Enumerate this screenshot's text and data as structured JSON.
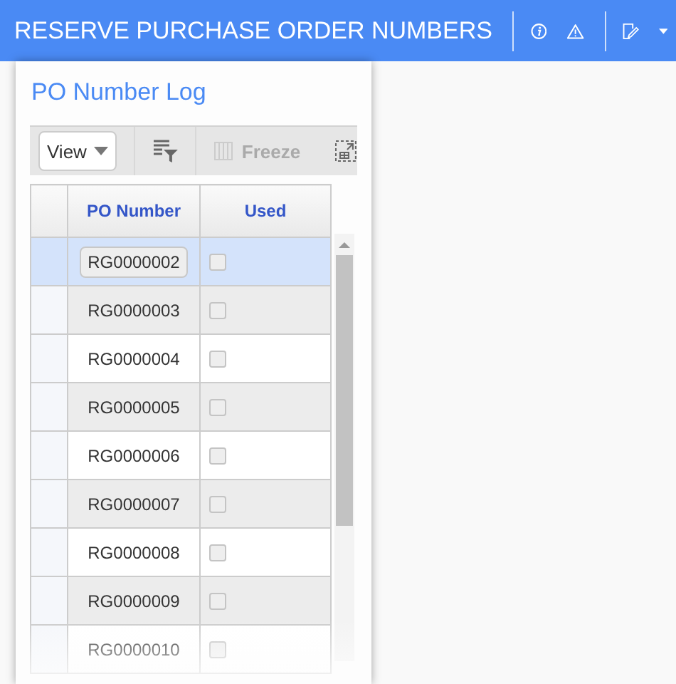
{
  "window": {
    "title": "RESERVE PURCHASE ORDER NUMBERS"
  },
  "panel": {
    "title": "PO Number Log",
    "toolbar": {
      "view": "View",
      "freeze": {
        "label": "Freeze",
        "disabled": true
      }
    },
    "table": {
      "columns": [
        "PO Number",
        "Used"
      ],
      "rows": [
        {
          "po": "RG0000002",
          "used": false,
          "selected": true
        },
        {
          "po": "RG0000003",
          "used": false,
          "selected": false
        },
        {
          "po": "RG0000004",
          "used": false,
          "selected": false
        },
        {
          "po": "RG0000005",
          "used": false,
          "selected": false
        },
        {
          "po": "RG0000006",
          "used": false,
          "selected": false
        },
        {
          "po": "RG0000007",
          "used": false,
          "selected": false
        },
        {
          "po": "RG0000008",
          "used": false,
          "selected": false
        },
        {
          "po": "RG0000009",
          "used": false,
          "selected": false
        },
        {
          "po": "RG0000010",
          "used": false,
          "selected": false
        }
      ]
    }
  }
}
